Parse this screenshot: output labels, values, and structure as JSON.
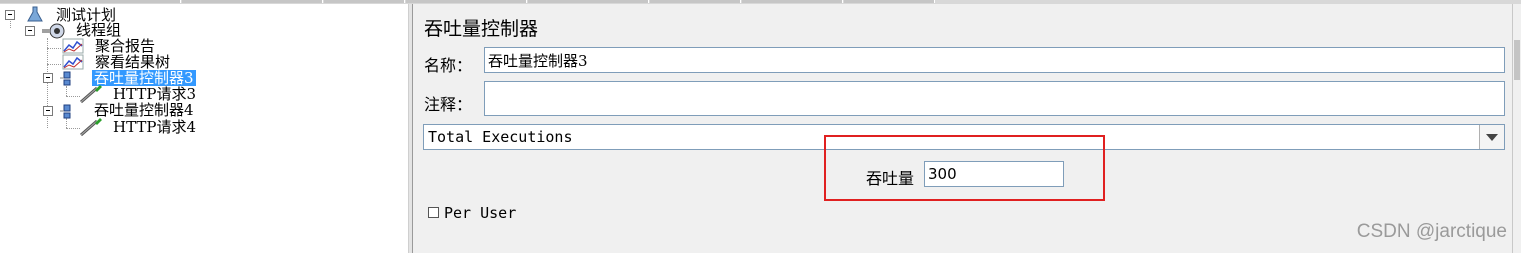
{
  "tree": {
    "nodes": [
      {
        "id": "test-plan",
        "label": "测试计划",
        "icon": "test-plan-icon",
        "selected": false
      },
      {
        "id": "thread-group",
        "label": "线程组",
        "icon": "thread-group-gear-icon",
        "selected": false
      },
      {
        "id": "aggregate-report",
        "label": "聚合报告",
        "icon": "listener-graph-icon",
        "selected": false
      },
      {
        "id": "view-results-tree",
        "label": "察看结果树",
        "icon": "listener-graph-icon",
        "selected": false
      },
      {
        "id": "throughput-controller-3",
        "label": "吞吐量控制器3",
        "icon": "controller-icon",
        "selected": true
      },
      {
        "id": "http-request-3",
        "label": "HTTP请求3",
        "icon": "sampler-pipette-icon",
        "selected": false
      },
      {
        "id": "throughput-controller-4",
        "label": "吞吐量控制器4",
        "icon": "controller-icon",
        "selected": false
      },
      {
        "id": "http-request-4",
        "label": "HTTP请求4",
        "icon": "sampler-pipette-icon",
        "selected": false
      }
    ]
  },
  "panel": {
    "title": "吞吐量控制器",
    "name_label": "名称：",
    "name_value": "吞吐量控制器3",
    "comment_label": "注释：",
    "comment_value": "",
    "mode_value": "Total Executions",
    "throughput_label": "吞吐量",
    "throughput_value": "300",
    "per_user_label": "Per User",
    "per_user_checked": false
  },
  "watermark": "CSDN @jarctique",
  "colors": {
    "selection": "#3399ff",
    "highlight_box": "#e02020",
    "panel_bg": "#f0f0f0"
  }
}
